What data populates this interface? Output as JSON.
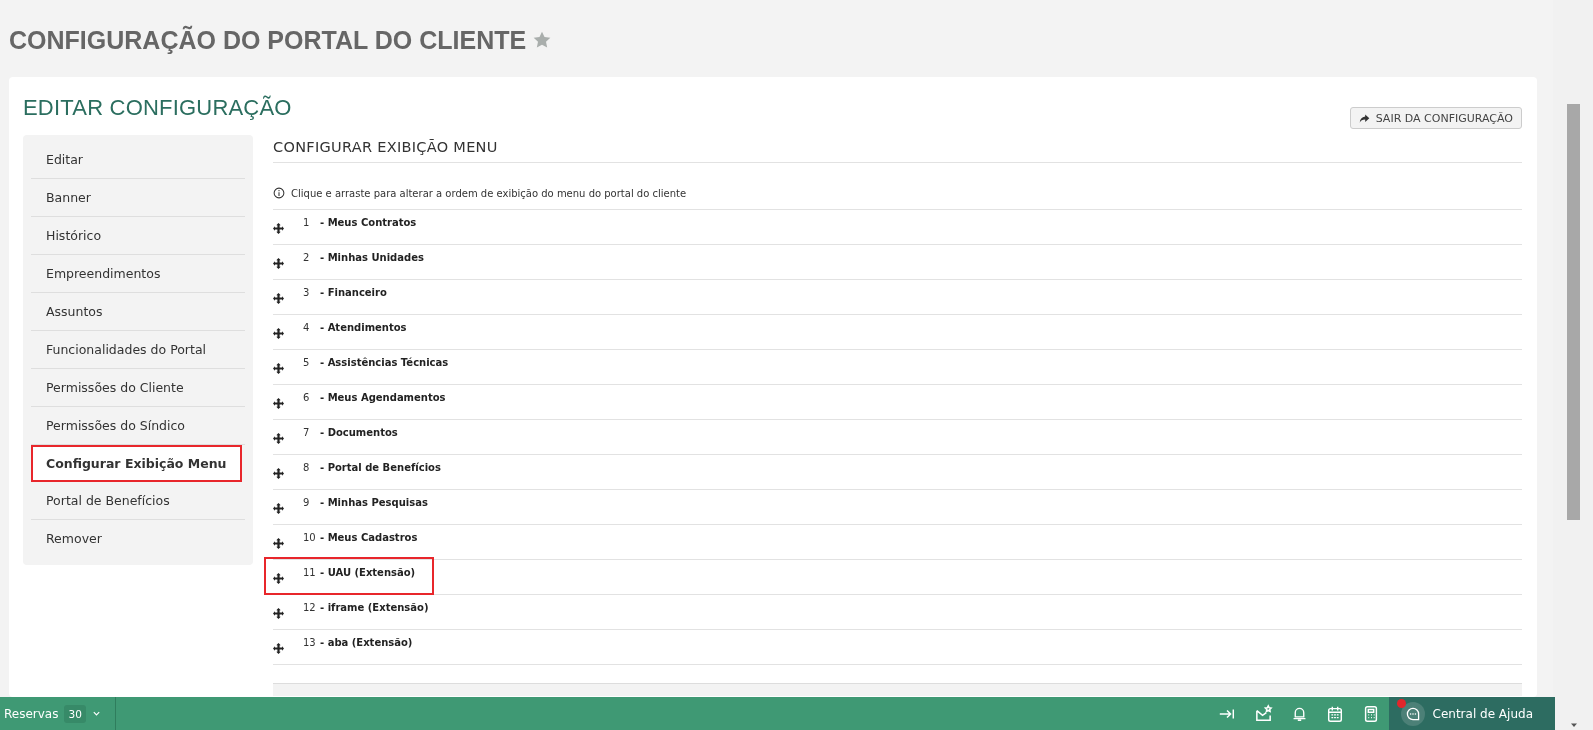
{
  "page_title": "CONFIGURAÇÃO DO PORTAL DO CLIENTE",
  "card": {
    "title": "EDITAR CONFIGURAÇÃO",
    "exit_button": "SAIR DA CONFIGURAÇÃO"
  },
  "sidebar": {
    "items": [
      {
        "label": "Editar",
        "selected": false
      },
      {
        "label": "Banner",
        "selected": false
      },
      {
        "label": "Histórico",
        "selected": false
      },
      {
        "label": "Empreendimentos",
        "selected": false
      },
      {
        "label": "Assuntos",
        "selected": false
      },
      {
        "label": "Funcionalidades do Portal",
        "selected": false
      },
      {
        "label": "Permissões do Cliente",
        "selected": false
      },
      {
        "label": "Permissões do Síndico",
        "selected": false
      },
      {
        "label": "Configurar Exibição Menu",
        "selected": true
      },
      {
        "label": "Portal de Benefícios",
        "selected": false
      },
      {
        "label": "Remover",
        "selected": false
      }
    ]
  },
  "section": {
    "title": "CONFIGURAR EXIBIÇÃO MENU",
    "hint": "Clique e arraste para alterar a ordem de exibição do menu do portal do cliente",
    "rows": [
      {
        "number": "1",
        "label": "- Meus Contratos",
        "highlighted": false
      },
      {
        "number": "2",
        "label": "- Minhas Unidades",
        "highlighted": false
      },
      {
        "number": "3",
        "label": "- Financeiro",
        "highlighted": false
      },
      {
        "number": "4",
        "label": "- Atendimentos",
        "highlighted": false
      },
      {
        "number": "5",
        "label": "- Assistências Técnicas",
        "highlighted": false
      },
      {
        "number": "6",
        "label": "- Meus Agendamentos",
        "highlighted": false
      },
      {
        "number": "7",
        "label": "- Documentos",
        "highlighted": false
      },
      {
        "number": "8",
        "label": "- Portal de Benefícios",
        "highlighted": false
      },
      {
        "number": "9",
        "label": "- Minhas Pesquisas",
        "highlighted": false
      },
      {
        "number": "10",
        "label": "- Meus Cadastros",
        "highlighted": false
      },
      {
        "number": "11",
        "label": "- UAU (Extensão)",
        "highlighted": true
      },
      {
        "number": "12",
        "label": "- iframe (Extensão)",
        "highlighted": false
      },
      {
        "number": "13",
        "label": "- aba (Extensão)",
        "highlighted": false
      }
    ]
  },
  "bottom_bar": {
    "reservas_label": "Reservas",
    "reservas_count": "30",
    "help_label": "Central de Ajuda",
    "help_notification": true
  }
}
